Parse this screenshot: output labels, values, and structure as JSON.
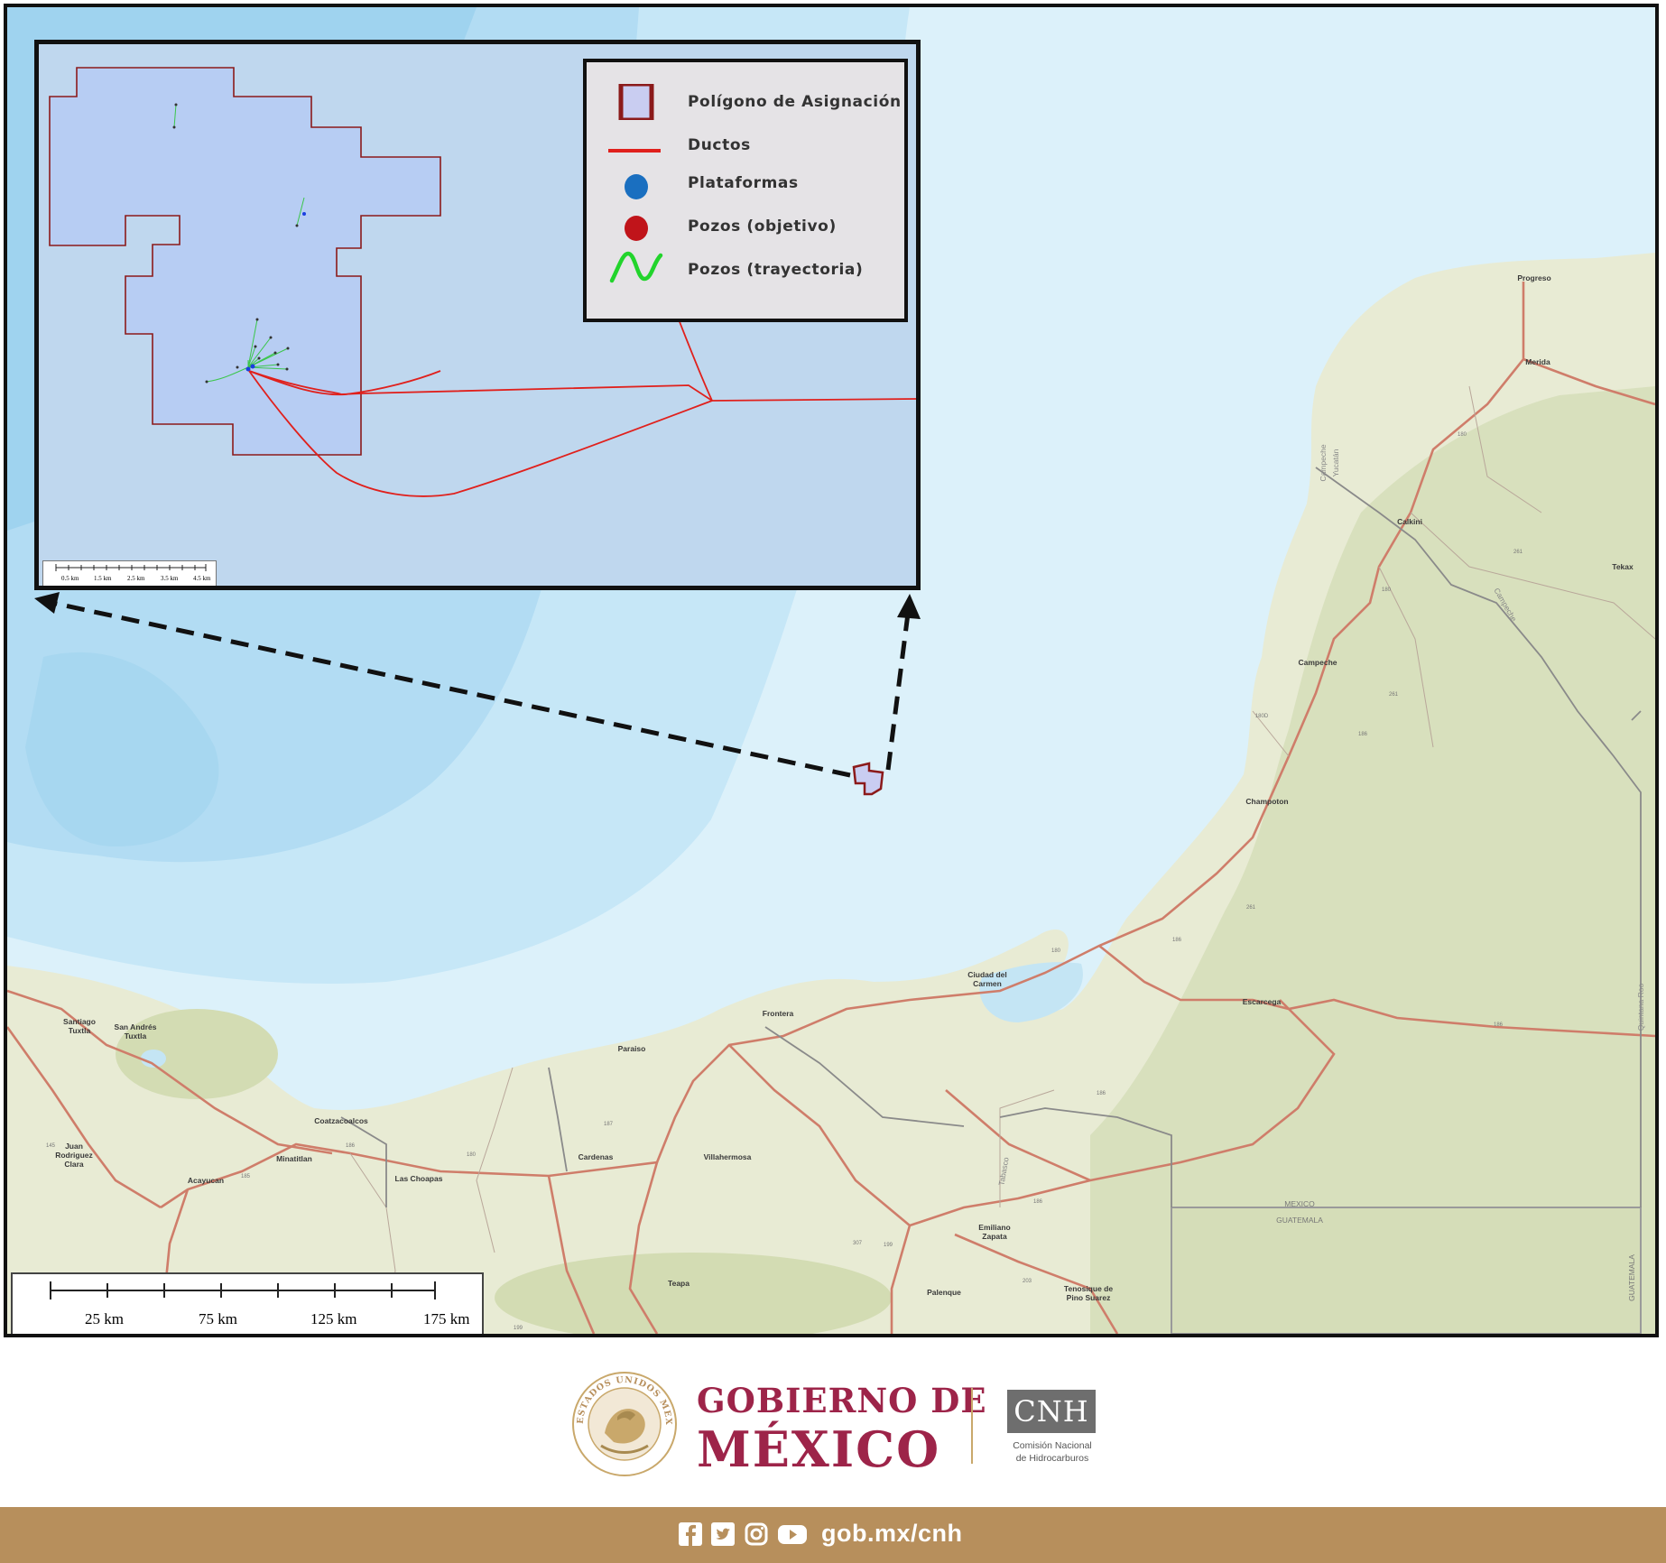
{
  "legend": {
    "items": [
      {
        "label": "Polígono de Asignación",
        "symbol": "polygon",
        "color": "#8b1a1a",
        "fill": "#c9cdf1"
      },
      {
        "label": "Ductos",
        "symbol": "line",
        "color": "#e0201c"
      },
      {
        "label": "Plataformas",
        "symbol": "dot",
        "color": "#1a6fc0"
      },
      {
        "label": "Pozos (objetivo)",
        "symbol": "dot",
        "color": "#c0141a"
      },
      {
        "label": "Pozos (trayectoria)",
        "symbol": "wave",
        "color": "#22d42c"
      }
    ]
  },
  "inset_scale": {
    "labels": [
      "0.5 km",
      "1.5 km",
      "2.5 km",
      "3.5 km",
      "4.5 km"
    ]
  },
  "main_scale": {
    "labels": [
      "25 km",
      "75 km",
      "125 km",
      "175 km"
    ]
  },
  "places": {
    "progreso": "Progreso",
    "merida": "Merida",
    "calkini": "Calkini",
    "tekax": "Tekax",
    "campeche": "Campeche",
    "champoton": "Champoton",
    "ciudad_carmen_1": "Ciudad del",
    "ciudad_carmen_2": "Carmen",
    "escarcega": "Escarcega",
    "frontera": "Frontera",
    "paraiso": "Paraiso",
    "coatzacoalcos": "Coatzacoalcos",
    "minatitlan": "Minatitlan",
    "acayucan": "Acayucan",
    "villahermosa": "Villahermosa",
    "cardenas": "Cardenas",
    "las_choapas": "Las Choapas",
    "emiliano_1": "Emiliano",
    "emiliano_2": "Zapata",
    "palenque": "Palenque",
    "tenosique_1": "Tenosique de",
    "tenosique_2": "Pino Suarez",
    "teapa": "Teapa",
    "santiago_1": "Santiago",
    "santiago_2": "Tuxtla",
    "san_andres_1": "San Andrés",
    "san_andres_2": "Tuxtla",
    "juan_1": "Juan",
    "juan_2": "Rodriguez",
    "juan_3": "Clara",
    "mexico": "MEXICO",
    "guatemala": "GUATEMALA",
    "guatemala_v": "GUATEMALA",
    "campeche_v": "Campeche",
    "yucatan_v": "Yucatán",
    "tabasco_v": "Tabasco",
    "quintana_v": "Quintana Roo"
  },
  "shields": {
    "s180a": "180",
    "s180b": "180",
    "s180c": "180",
    "s261a": "261",
    "s261b": "261",
    "s186a": "186",
    "s186b": "186",
    "s186c": "186",
    "s186d": "186",
    "s180d": "180D",
    "s261c": "261",
    "s199": "199",
    "s186e": "186",
    "s187": "187",
    "s180e": "180",
    "s145": "145",
    "s185": "185",
    "s186f": "186",
    "s307": "307",
    "s199b": "199",
    "s203": "203"
  },
  "footer": {
    "gob_line1": "GOBIERNO DE",
    "gob_line2": "MÉXICO",
    "seal_text": "ESTADOS UNIDOS MEXICANOS",
    "cnh": "CNH",
    "cnh_sub1": "Comisión Nacional",
    "cnh_sub2": "de Hidrocarburos",
    "url": "gob.mx/cnh"
  },
  "colors": {
    "deep_sea": "#8fcbee",
    "sea": "#bfe3f6",
    "shallow_sea": "#dcf1fa",
    "land": "#e8ebd4",
    "green_land": "#d8e0bd",
    "road": "#cf7d6a",
    "brand_red": "#9d2449",
    "brand_gold": "#b78f5c"
  }
}
